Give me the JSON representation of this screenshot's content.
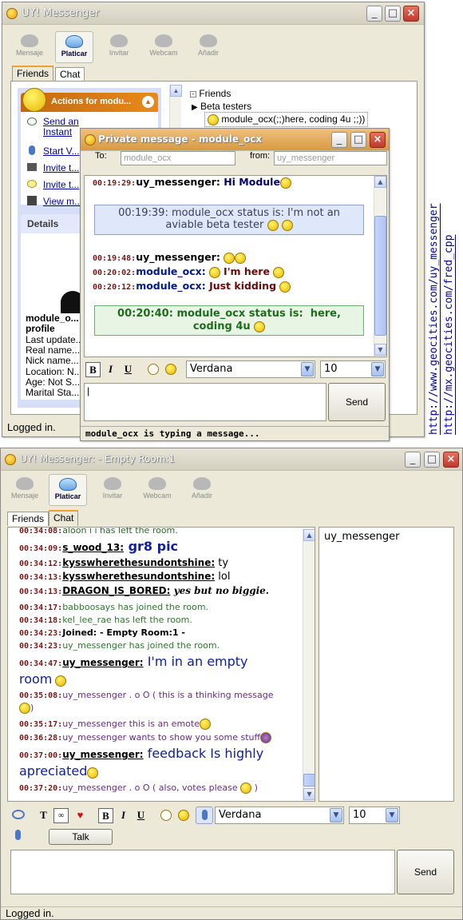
{
  "toolbar_items": [
    "Mensaje",
    "Platicar",
    "Invitar",
    "Webcam",
    "Añadir"
  ],
  "win1": {
    "title": "UY! Messenger",
    "tabs": [
      "Friends",
      "Chat"
    ],
    "actions_header": "Actions for modu...",
    "actions": [
      "Send an Instant Message",
      "Start V...",
      "Invite t...",
      "Invite t...",
      "View m..."
    ],
    "details_header": "Details",
    "details": [
      "module_o...",
      "profile",
      "Last update...",
      "Real name...",
      "Nick name...",
      "Location: N...",
      "Age: Not S...",
      "Marital Sta..."
    ],
    "tree": {
      "group": "Friends",
      "subgroup": "Beta testers",
      "contact": "module_ocx(;;)here, coding 4u ;;))"
    },
    "status": "Logged in."
  },
  "pm": {
    "title": "Private message - module_ocx",
    "to_label": "To:",
    "to_value": "module_ocx",
    "from_label": "from:",
    "from_value": "uy_messenger",
    "lines": [
      {
        "ts": "00:19:29:",
        "who": "uy_messenger:",
        "text": " Hi Module"
      },
      {
        "ts": "00:19:48:",
        "who": "uy_messenger:",
        "text": ""
      },
      {
        "ts": "00:20:02:",
        "who": "module_ocx:",
        "text": " I'm here"
      },
      {
        "ts": "00:20:12:",
        "who": "module_ocx:",
        "text": " Just kidding"
      }
    ],
    "notice1": "00:19:39: module_ocx status is: I'm not an aviable beta tester",
    "notice2": "00:20:40: module_ocx status is:  here, coding 4u",
    "font": "Verdana",
    "size": "10",
    "send": "Send",
    "typing": "module_ocx is typing a message..."
  },
  "links": [
    "http://www.geocities.com/uy_messenger",
    "http://mx.geocities.com/fred_cpp"
  ],
  "win2": {
    "title": "UY! Messenger:  - Empty Room:1",
    "tabs": [
      "Friends",
      "Chat"
    ],
    "chat": [
      {
        "ts": "00:34:08:",
        "text": "aloon i i has left the room."
      },
      {
        "ts": "00:34:09:",
        "who": "s_wood_13:",
        "text": " gr8 pic"
      },
      {
        "ts": "00:34:12:",
        "who": "kysswherethesundontshine:",
        "text": " ty"
      },
      {
        "ts": "00:34:13:",
        "who": "kysswherethesundontshine:",
        "text": " lol"
      },
      {
        "ts": "00:34:13:",
        "who": "DRAGON_IS_BORED:",
        "text": " yes but no biggie."
      },
      {
        "ts": "00:34:17:",
        "text": "babboosays has joined the room."
      },
      {
        "ts": "00:34:18:",
        "text": "kel_lee_rae has left the room."
      },
      {
        "ts": "00:34:23:",
        "text": "Joined: - Empty Room:1 -"
      },
      {
        "ts": "00:34:23:",
        "text": "uy_messenger has joined the room."
      },
      {
        "ts": "00:34:47:",
        "who": "uy_messenger:",
        "text": " I'm in an empty",
        "text2": "room"
      },
      {
        "ts": "00:35:08:",
        "text": "uy_messenger . o O ( this is a thinking message",
        "text2": ")"
      },
      {
        "ts": "00:35:17:",
        "text": "uy_messenger this is an emote"
      },
      {
        "ts": "00:36:28:",
        "text": "uy_messenger wants to show you some stuff"
      },
      {
        "ts": "00:37:00:",
        "who": "uy_messenger:",
        "text": " feedback Is highly",
        "text2": "apreciated"
      },
      {
        "ts": "00:37:20:",
        "text": "uy_messenger . o O ( also, votes please "
      }
    ],
    "user_list": [
      "uy_messenger"
    ],
    "font": "Verdana",
    "size": "10",
    "talk": "Talk",
    "send": "Send",
    "status": "Logged in."
  }
}
